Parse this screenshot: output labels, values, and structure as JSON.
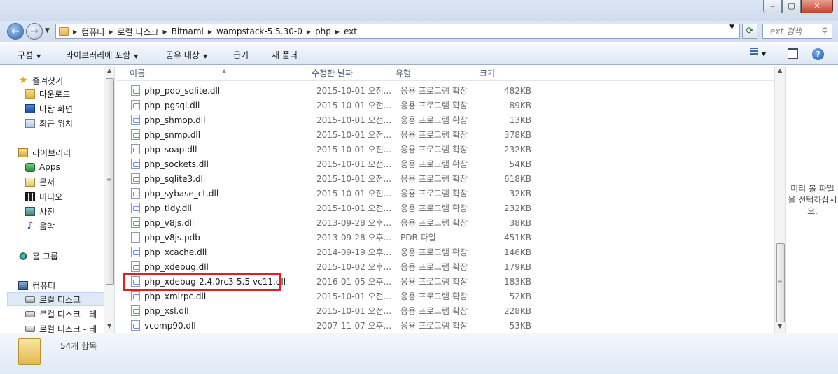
{
  "window": {
    "min": "‒",
    "max": "▢",
    "close": "✕"
  },
  "address": {
    "crumbs": [
      "컴퓨터",
      "로컬 디스크",
      "Bitnami",
      "wampstack-5.5.30-0",
      "php",
      "ext"
    ],
    "search_placeholder": "ext 검색"
  },
  "toolbar": {
    "organize": "구성",
    "include_library": "라이브러리에 포함",
    "share_with": "공유 대상",
    "burn": "굽기",
    "new_folder": "새 폴더",
    "help": "?"
  },
  "nav": {
    "favorites": "즐겨찾기",
    "downloads": "다운로드",
    "desktop": "바탕 화면",
    "recent": "최근 위치",
    "libraries": "라이브러리",
    "apps": "Apps",
    "documents": "문서",
    "videos": "비디오",
    "pictures": "사진",
    "music": "음악",
    "homegroup": "홈 그룹",
    "computer": "컴퓨터",
    "local_disk": "로컬 디스크",
    "local_disk_2": "로컬 디스크 - 레",
    "local_disk_3": "로컬 디스크 - 레"
  },
  "columns": {
    "name": "이름",
    "date": "수정한 날짜",
    "type": "유형",
    "size": "크기"
  },
  "files": [
    {
      "name": "php_pdo_sqlite.dll",
      "date": "2015-10-01 오전...",
      "type": "응용 프로그램 확장",
      "size": "482KB",
      "icon": "dll"
    },
    {
      "name": "php_pgsql.dll",
      "date": "2015-10-01 오전...",
      "type": "응용 프로그램 확장",
      "size": "89KB",
      "icon": "dll"
    },
    {
      "name": "php_shmop.dll",
      "date": "2015-10-01 오전...",
      "type": "응용 프로그램 확장",
      "size": "13KB",
      "icon": "dll"
    },
    {
      "name": "php_snmp.dll",
      "date": "2015-10-01 오전...",
      "type": "응용 프로그램 확장",
      "size": "378KB",
      "icon": "dll"
    },
    {
      "name": "php_soap.dll",
      "date": "2015-10-01 오전...",
      "type": "응용 프로그램 확장",
      "size": "232KB",
      "icon": "dll"
    },
    {
      "name": "php_sockets.dll",
      "date": "2015-10-01 오전...",
      "type": "응용 프로그램 확장",
      "size": "54KB",
      "icon": "dll"
    },
    {
      "name": "php_sqlite3.dll",
      "date": "2015-10-01 오전...",
      "type": "응용 프로그램 확장",
      "size": "618KB",
      "icon": "dll"
    },
    {
      "name": "php_sybase_ct.dll",
      "date": "2015-10-01 오전...",
      "type": "응용 프로그램 확장",
      "size": "32KB",
      "icon": "dll"
    },
    {
      "name": "php_tidy.dll",
      "date": "2015-10-01 오전...",
      "type": "응용 프로그램 확장",
      "size": "232KB",
      "icon": "dll"
    },
    {
      "name": "php_v8js.dll",
      "date": "2013-09-28 오후...",
      "type": "응용 프로그램 확장",
      "size": "38KB",
      "icon": "dll"
    },
    {
      "name": "php_v8js.pdb",
      "date": "2013-09-28 오후...",
      "type": "PDB 파일",
      "size": "451KB",
      "icon": "file"
    },
    {
      "name": "php_xcache.dll",
      "date": "2014-09-19 오후...",
      "type": "응용 프로그램 확장",
      "size": "146KB",
      "icon": "dll"
    },
    {
      "name": "php_xdebug.dll",
      "date": "2015-10-02 오후...",
      "type": "응용 프로그램 확장",
      "size": "179KB",
      "icon": "dll"
    },
    {
      "name": "php_xdebug-2.4.0rc3-5.5-vc11.dll",
      "date": "2016-01-05 오후...",
      "type": "응용 프로그램 확장",
      "size": "183KB",
      "icon": "dll",
      "highlighted": true
    },
    {
      "name": "php_xmlrpc.dll",
      "date": "2015-10-01 오전...",
      "type": "응용 프로그램 확장",
      "size": "52KB",
      "icon": "dll"
    },
    {
      "name": "php_xsl.dll",
      "date": "2015-10-01 오전...",
      "type": "응용 프로그램 확장",
      "size": "228KB",
      "icon": "dll"
    },
    {
      "name": "vcomp90.dll",
      "date": "2007-11-07 오후...",
      "type": "응용 프로그램 확장",
      "size": "53KB",
      "icon": "dll"
    }
  ],
  "preview": {
    "message": "미리 볼 파일을 선택하십시오."
  },
  "status": {
    "count": "54개 항목"
  },
  "colors": {
    "highlight": "#e01f24",
    "chrome": "#dce7f5"
  }
}
